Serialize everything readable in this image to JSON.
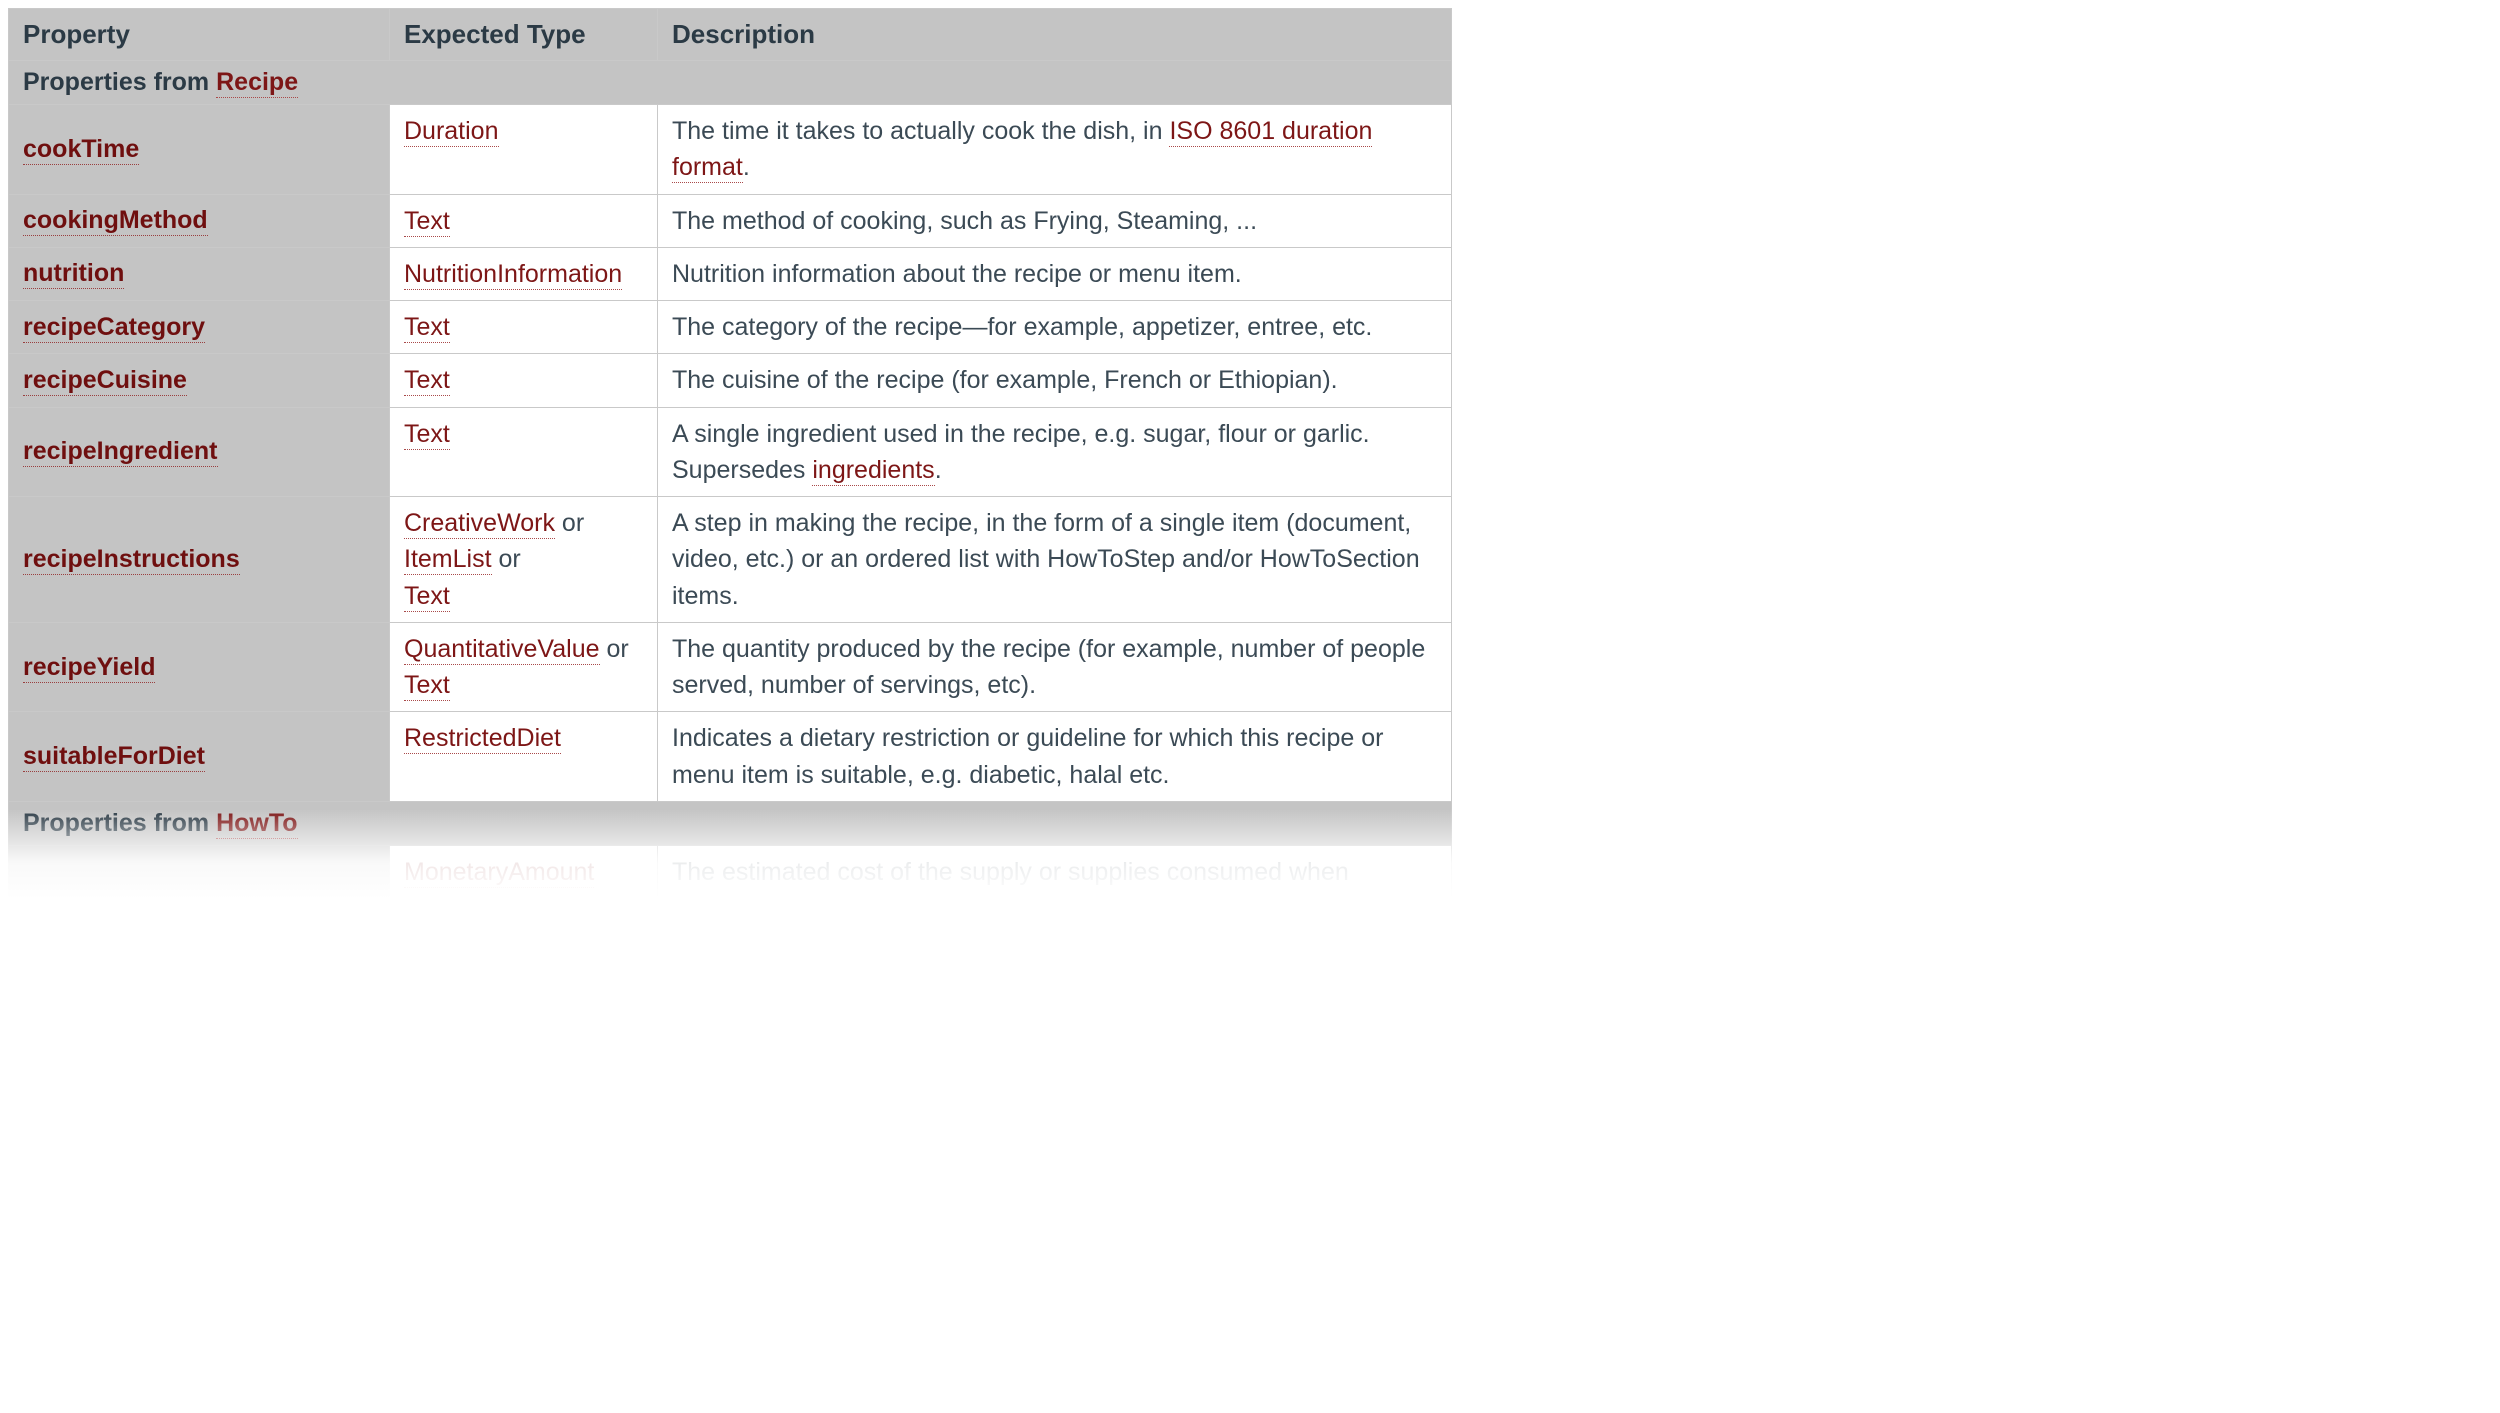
{
  "headers": {
    "property": "Property",
    "expected_type": "Expected Type",
    "description": "Description"
  },
  "sections": [
    {
      "title_prefix": "Properties from ",
      "title_link": "Recipe",
      "rows": [
        {
          "property": "cookTime",
          "types": [
            {
              "name": "Duration"
            }
          ],
          "desc_parts": [
            {
              "text": "The time it takes to actually cook the dish, in "
            },
            {
              "link": "ISO 8601 duration format"
            },
            {
              "text": "."
            }
          ]
        },
        {
          "property": "cookingMethod",
          "types": [
            {
              "name": "Text"
            }
          ],
          "desc_parts": [
            {
              "text": "The method of cooking, such as Frying, Steaming, ..."
            }
          ]
        },
        {
          "property": "nutrition",
          "types": [
            {
              "name": "NutritionInformation"
            }
          ],
          "desc_parts": [
            {
              "text": "Nutrition information about the recipe or menu item."
            }
          ]
        },
        {
          "property": "recipeCategory",
          "types": [
            {
              "name": "Text"
            }
          ],
          "desc_parts": [
            {
              "text": "The category of the recipe—for example, appetizer, entree, etc."
            }
          ]
        },
        {
          "property": "recipeCuisine",
          "types": [
            {
              "name": "Text"
            }
          ],
          "desc_parts": [
            {
              "text": "The cuisine of the recipe (for example, French or Ethiopian)."
            }
          ]
        },
        {
          "property": "recipeIngredient",
          "types": [
            {
              "name": "Text"
            }
          ],
          "desc_parts": [
            {
              "text": "A single ingredient used in the recipe, e.g. sugar, flour or garlic. Supersedes "
            },
            {
              "link": "ingredients"
            },
            {
              "text": "."
            }
          ]
        },
        {
          "property": "recipeInstructions",
          "types": [
            {
              "name": "CreativeWork"
            },
            {
              "name": "ItemList"
            },
            {
              "name": "Text"
            }
          ],
          "desc_parts": [
            {
              "text": "A step in making the recipe, in the form of a single item (document, video, etc.) or an ordered list with HowToStep and/or HowToSection items."
            }
          ]
        },
        {
          "property": "recipeYield",
          "types": [
            {
              "name": "QuantitativeValue"
            },
            {
              "name": "Text"
            }
          ],
          "desc_parts": [
            {
              "text": "The quantity produced by the recipe (for example, number of people served, number of servings, etc)."
            }
          ]
        },
        {
          "property": "suitableForDiet",
          "types": [
            {
              "name": "RestrictedDiet"
            }
          ],
          "desc_parts": [
            {
              "text": "Indicates a dietary restriction or guideline for which this recipe or menu item is suitable, e.g. diabetic, halal etc."
            }
          ]
        }
      ]
    },
    {
      "title_prefix": "Properties from ",
      "title_link": "HowTo",
      "rows": [
        {
          "property": "",
          "types": [
            {
              "name": "MonetaryAmount"
            }
          ],
          "desc_parts": [
            {
              "text": "The estimated cost of the supply or supplies consumed when"
            }
          ]
        }
      ]
    }
  ],
  "or_sep": "  or"
}
